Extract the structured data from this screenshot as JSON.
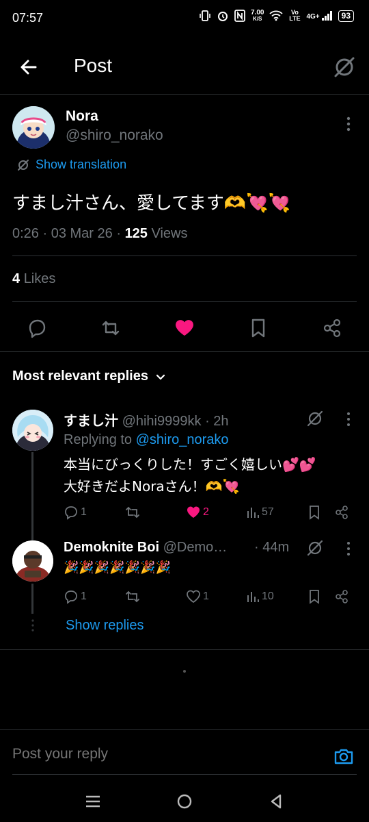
{
  "status": {
    "time": "07:57",
    "speed": "7.00",
    "speed_unit": "K/S",
    "volte": "Vo LTE",
    "network": "4G+",
    "battery": "93"
  },
  "header": {
    "title": "Post"
  },
  "post": {
    "author_name": "Nora",
    "author_handle": "@shiro_norako",
    "show_translation": "Show translation",
    "text": "すまし汁さん、愛してます🫶💘💘",
    "time": "0:26",
    "date": "03 Mar 26",
    "views_count": "125",
    "views_label": "Views",
    "likes_count": "4",
    "likes_label": "Likes",
    "liked": true
  },
  "replies_sort": {
    "label": "Most relevant replies"
  },
  "replies": [
    {
      "name": "すまし汁",
      "handle": "@hihi9999kk",
      "age": "2h",
      "replying_to_label": "Replying to",
      "replying_to_handle": "@shiro_norako",
      "line1": "本当にびっくりした！すごく嬉しい💕💕",
      "line2": "大好きだよNoraさん！🫶💘",
      "comments": "1",
      "reposts": "",
      "likes": "2",
      "liked": true,
      "views": "57"
    },
    {
      "name": "Demoknite Boi",
      "handle": "@Demo…",
      "age": "44m",
      "text": "🎉🎉🎉🎉🎉🎉🎉",
      "comments": "1",
      "reposts": "",
      "likes": "1",
      "liked": false,
      "views": "10"
    }
  ],
  "show_replies": "Show replies",
  "reply_bar": {
    "placeholder": "Post your reply"
  },
  "colors": {
    "accent": "#1d9bf0",
    "like": "#f91880",
    "muted": "#71767b",
    "background": "#000000"
  }
}
